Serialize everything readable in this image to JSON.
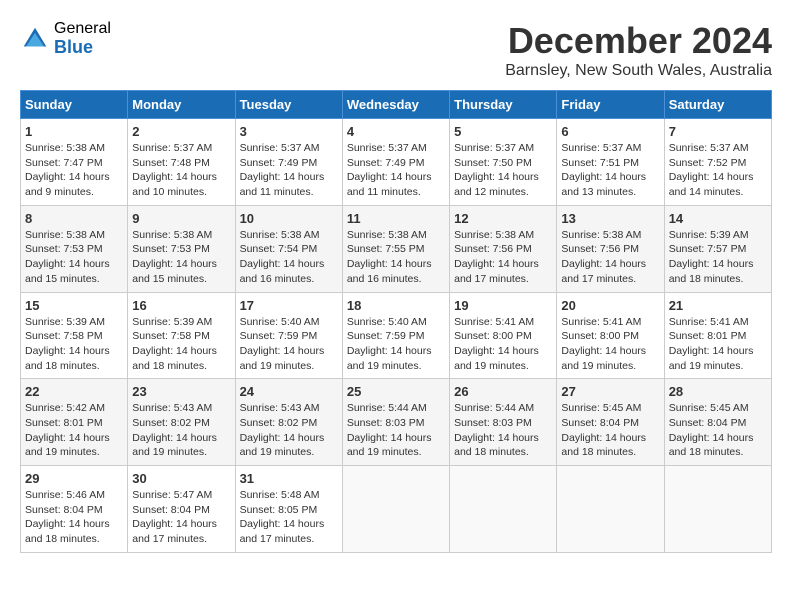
{
  "logo": {
    "general": "General",
    "blue": "Blue"
  },
  "title": {
    "month": "December 2024",
    "location": "Barnsley, New South Wales, Australia"
  },
  "weekdays": [
    "Sunday",
    "Monday",
    "Tuesday",
    "Wednesday",
    "Thursday",
    "Friday",
    "Saturday"
  ],
  "weeks": [
    [
      {
        "day": 1,
        "sunrise": "5:38 AM",
        "sunset": "7:47 PM",
        "daylight": "14 hours and 9 minutes."
      },
      {
        "day": 2,
        "sunrise": "5:37 AM",
        "sunset": "7:48 PM",
        "daylight": "14 hours and 10 minutes."
      },
      {
        "day": 3,
        "sunrise": "5:37 AM",
        "sunset": "7:49 PM",
        "daylight": "14 hours and 11 minutes."
      },
      {
        "day": 4,
        "sunrise": "5:37 AM",
        "sunset": "7:49 PM",
        "daylight": "14 hours and 11 minutes."
      },
      {
        "day": 5,
        "sunrise": "5:37 AM",
        "sunset": "7:50 PM",
        "daylight": "14 hours and 12 minutes."
      },
      {
        "day": 6,
        "sunrise": "5:37 AM",
        "sunset": "7:51 PM",
        "daylight": "14 hours and 13 minutes."
      },
      {
        "day": 7,
        "sunrise": "5:37 AM",
        "sunset": "7:52 PM",
        "daylight": "14 hours and 14 minutes."
      }
    ],
    [
      {
        "day": 8,
        "sunrise": "5:38 AM",
        "sunset": "7:53 PM",
        "daylight": "14 hours and 15 minutes."
      },
      {
        "day": 9,
        "sunrise": "5:38 AM",
        "sunset": "7:53 PM",
        "daylight": "14 hours and 15 minutes."
      },
      {
        "day": 10,
        "sunrise": "5:38 AM",
        "sunset": "7:54 PM",
        "daylight": "14 hours and 16 minutes."
      },
      {
        "day": 11,
        "sunrise": "5:38 AM",
        "sunset": "7:55 PM",
        "daylight": "14 hours and 16 minutes."
      },
      {
        "day": 12,
        "sunrise": "5:38 AM",
        "sunset": "7:56 PM",
        "daylight": "14 hours and 17 minutes."
      },
      {
        "day": 13,
        "sunrise": "5:38 AM",
        "sunset": "7:56 PM",
        "daylight": "14 hours and 17 minutes."
      },
      {
        "day": 14,
        "sunrise": "5:39 AM",
        "sunset": "7:57 PM",
        "daylight": "14 hours and 18 minutes."
      }
    ],
    [
      {
        "day": 15,
        "sunrise": "5:39 AM",
        "sunset": "7:58 PM",
        "daylight": "14 hours and 18 minutes."
      },
      {
        "day": 16,
        "sunrise": "5:39 AM",
        "sunset": "7:58 PM",
        "daylight": "14 hours and 18 minutes."
      },
      {
        "day": 17,
        "sunrise": "5:40 AM",
        "sunset": "7:59 PM",
        "daylight": "14 hours and 19 minutes."
      },
      {
        "day": 18,
        "sunrise": "5:40 AM",
        "sunset": "7:59 PM",
        "daylight": "14 hours and 19 minutes."
      },
      {
        "day": 19,
        "sunrise": "5:41 AM",
        "sunset": "8:00 PM",
        "daylight": "14 hours and 19 minutes."
      },
      {
        "day": 20,
        "sunrise": "5:41 AM",
        "sunset": "8:00 PM",
        "daylight": "14 hours and 19 minutes."
      },
      {
        "day": 21,
        "sunrise": "5:41 AM",
        "sunset": "8:01 PM",
        "daylight": "14 hours and 19 minutes."
      }
    ],
    [
      {
        "day": 22,
        "sunrise": "5:42 AM",
        "sunset": "8:01 PM",
        "daylight": "14 hours and 19 minutes."
      },
      {
        "day": 23,
        "sunrise": "5:43 AM",
        "sunset": "8:02 PM",
        "daylight": "14 hours and 19 minutes."
      },
      {
        "day": 24,
        "sunrise": "5:43 AM",
        "sunset": "8:02 PM",
        "daylight": "14 hours and 19 minutes."
      },
      {
        "day": 25,
        "sunrise": "5:44 AM",
        "sunset": "8:03 PM",
        "daylight": "14 hours and 19 minutes."
      },
      {
        "day": 26,
        "sunrise": "5:44 AM",
        "sunset": "8:03 PM",
        "daylight": "14 hours and 18 minutes."
      },
      {
        "day": 27,
        "sunrise": "5:45 AM",
        "sunset": "8:04 PM",
        "daylight": "14 hours and 18 minutes."
      },
      {
        "day": 28,
        "sunrise": "5:45 AM",
        "sunset": "8:04 PM",
        "daylight": "14 hours and 18 minutes."
      }
    ],
    [
      {
        "day": 29,
        "sunrise": "5:46 AM",
        "sunset": "8:04 PM",
        "daylight": "14 hours and 18 minutes."
      },
      {
        "day": 30,
        "sunrise": "5:47 AM",
        "sunset": "8:04 PM",
        "daylight": "14 hours and 17 minutes."
      },
      {
        "day": 31,
        "sunrise": "5:48 AM",
        "sunset": "8:05 PM",
        "daylight": "14 hours and 17 minutes."
      },
      null,
      null,
      null,
      null
    ]
  ],
  "labels": {
    "sunrise": "Sunrise:",
    "sunset": "Sunset:",
    "daylight": "Daylight:"
  }
}
